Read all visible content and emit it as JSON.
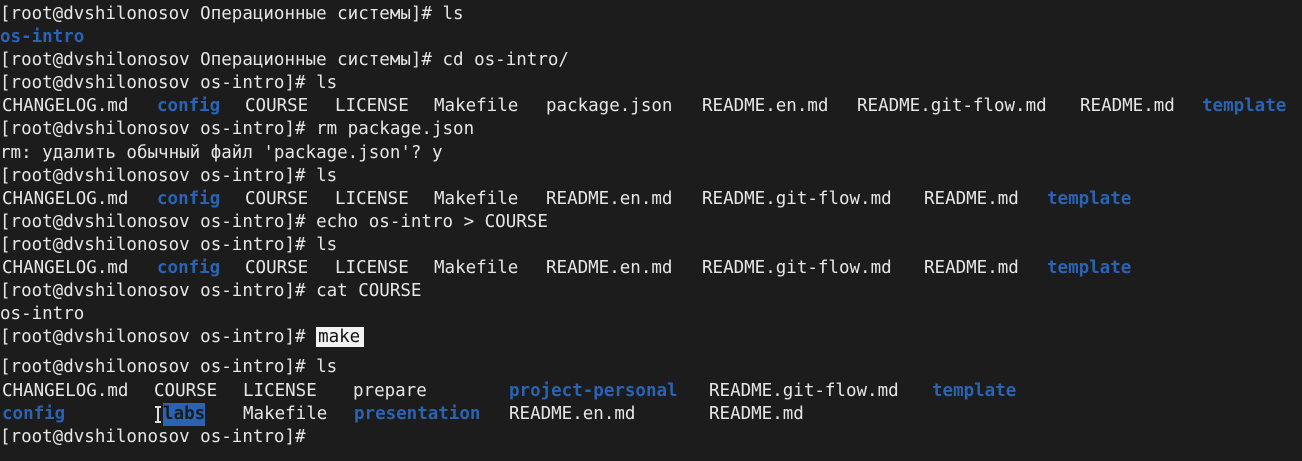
{
  "terminal": {
    "lines": [
      {
        "text": "[root@dvshilonosov Операционные системы]# ls"
      },
      {
        "text": "os-intro",
        "type": "dir"
      },
      {
        "text": "[root@dvshilonosov Операционные системы]# cd os-intro/"
      },
      {
        "text": "[root@dvshilonosov os-intro]# ls"
      },
      {
        "tokens": [
          {
            "text": "CHANGELOG.md"
          },
          {
            "text": "config",
            "dir": true
          },
          {
            "text": "COURSE"
          },
          {
            "text": "LICENSE"
          },
          {
            "text": "Makefile"
          },
          {
            "text": "package.json"
          },
          {
            "text": "README.en.md"
          },
          {
            "text": "README.git-flow.md"
          },
          {
            "text": "README.md"
          },
          {
            "text": "template",
            "dir": true
          }
        ]
      },
      {
        "text": "[root@dvshilonosov os-intro]# rm package.json"
      },
      {
        "text": "rm: удалить обычный файл 'package.json'? y"
      },
      {
        "text": "[root@dvshilonosov os-intro]# ls"
      },
      {
        "tokens": [
          {
            "text": "CHANGELOG.md"
          },
          {
            "text": "config",
            "dir": true
          },
          {
            "text": "COURSE"
          },
          {
            "text": "LICENSE"
          },
          {
            "text": "Makefile"
          },
          {
            "text": "README.en.md"
          },
          {
            "text": "README.git-flow.md"
          },
          {
            "text": "README.md"
          },
          {
            "text": "template",
            "dir": true
          }
        ]
      },
      {
        "text": "[root@dvshilonosov os-intro]# echo os-intro > COURSE"
      },
      {
        "text": "[root@dvshilonosov os-intro]# ls"
      },
      {
        "tokens": [
          {
            "text": "CHANGELOG.md"
          },
          {
            "text": "config",
            "dir": true
          },
          {
            "text": "COURSE"
          },
          {
            "text": "LICENSE"
          },
          {
            "text": "Makefile"
          },
          {
            "text": "README.en.md"
          },
          {
            "text": "README.git-flow.md"
          },
          {
            "text": "README.md"
          },
          {
            "text": "template",
            "dir": true
          }
        ]
      },
      {
        "text": "[root@dvshilonosov os-intro]# cat COURSE"
      },
      {
        "text": "os-intro"
      },
      {
        "prompt": "[root@dvshilonosov os-intro]# ",
        "highlighted_command": "make"
      },
      {
        "text": "[root@dvshilonosov os-intro]# ls"
      },
      {
        "tokens": [
          {
            "text": "CHANGELOG.md"
          },
          {
            "text": "COURSE"
          },
          {
            "text": "LICENSE"
          },
          {
            "text": "prepare"
          },
          {
            "text": "project-personal",
            "dir": true
          },
          {
            "text": "README.git-flow.md"
          },
          {
            "text": "template",
            "dir": true
          }
        ]
      },
      {
        "tokens": [
          {
            "text": "config",
            "dir": true
          },
          {
            "text": "labs",
            "dir": true,
            "selected": true
          },
          {
            "text": "Makefile"
          },
          {
            "text": "presentation",
            "dir": true
          },
          {
            "text": "README.en.md"
          },
          {
            "text": "README.md"
          }
        ]
      },
      {
        "text": "[root@dvshilonosov os-intro]#"
      }
    ]
  },
  "colors": {
    "background": "#1c1c1c",
    "foreground": "#e6e6e6",
    "directory": "#2a63b3",
    "highlight": "#f2f2f2"
  },
  "icons": {
    "mouse_cursor": "text-ibeam-cursor"
  }
}
